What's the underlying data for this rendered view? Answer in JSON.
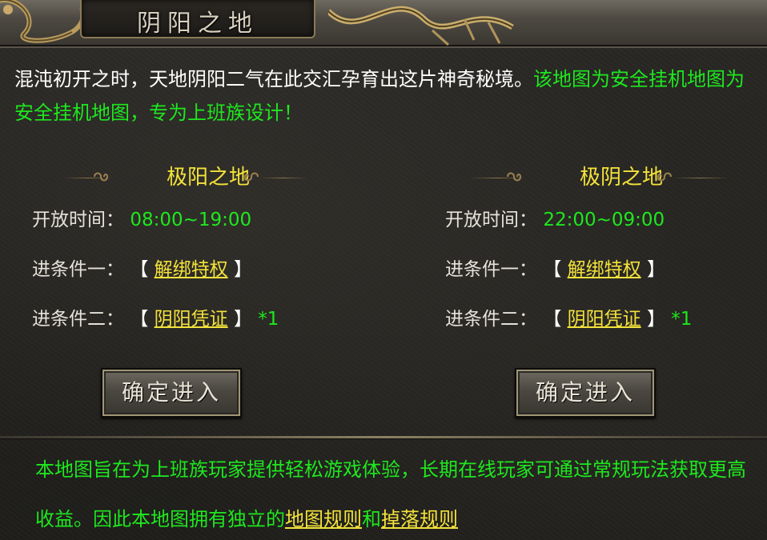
{
  "header": {
    "title": "阴阳之地"
  },
  "intro": {
    "text_white": "混沌初开之时，天地阴阳二气在此交汇孕育出这片神奇秘境。",
    "text_green": "该地图为安全挂机地图为安全挂机地图，专为上班族设计！"
  },
  "left": {
    "title": "极阳之地",
    "time_label": "开放时间：",
    "time_value": "08:00~19:00",
    "cond1_label": "进条件一：",
    "cond1_open": "【",
    "cond1_link": "解绑特权",
    "cond1_close": "】",
    "cond2_label": "进条件二：",
    "cond2_open": "【",
    "cond2_link": "阴阳凭证",
    "cond2_close": "】",
    "cond2_qty": "*1",
    "button": "确定进入"
  },
  "right": {
    "title": "极阴之地",
    "time_label": "开放时间：",
    "time_value": "22:00~09:00",
    "cond1_label": "进条件一：",
    "cond1_open": "【",
    "cond1_link": "解绑特权",
    "cond1_close": "】",
    "cond2_label": "进条件二：",
    "cond2_open": "【",
    "cond2_link": "阴阳凭证",
    "cond2_close": "】",
    "cond2_qty": "*1",
    "button": "确定进入"
  },
  "footer": {
    "text": "本地图旨在为上班族玩家提供轻松游戏体验，长期在线玩家可通过常规玩法获取更高收益。因此本地图拥有独立的",
    "link1": "地图规则",
    "and": "和",
    "link2": "掉落规则"
  },
  "colors": {
    "green_text": "#1ee81e",
    "yellow_text": "#f3e23a",
    "white_text": "#ffffff"
  },
  "icons": [
    "dragon-ornament-left-icon",
    "dragon-ornament-right-icon",
    "scroll-knot-icon"
  ]
}
